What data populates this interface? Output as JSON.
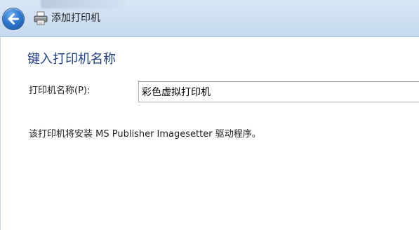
{
  "window": {
    "title": "添加打印机",
    "icons": {
      "back": "back-arrow-icon",
      "printer": "printer-icon"
    },
    "colors": {
      "titlebar": "#cfe0f2",
      "heading": "#1f3f84",
      "back_button": "#2e78d0"
    }
  },
  "page": {
    "heading": "键入打印机名称",
    "printer_name_label": "打印机名称(P):",
    "printer_name_value": "彩色虚拟打印机",
    "driver_note": "该打印机将安装 MS Publisher Imagesetter 驱动程序。"
  }
}
